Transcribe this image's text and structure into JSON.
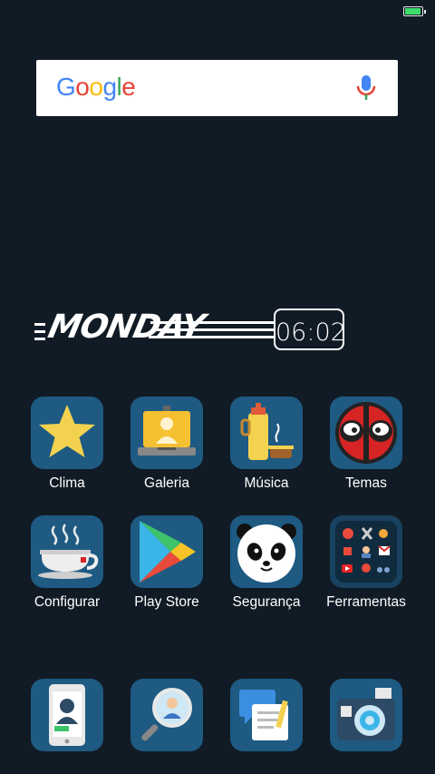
{
  "status_bar": {
    "battery_level": 1.0,
    "battery_color": "#3ddc6a"
  },
  "search": {
    "logo_text": "Google",
    "mic_icon": "mic-icon"
  },
  "clock_widget": {
    "day": "MONDAY",
    "time": "06:02"
  },
  "apps_row1": [
    {
      "label": "Clima",
      "icon": "star-icon"
    },
    {
      "label": "Galeria",
      "icon": "laptop-user-icon"
    },
    {
      "label": "Música",
      "icon": "thermos-icon"
    },
    {
      "label": "Temas",
      "icon": "deadpool-mask-icon"
    }
  ],
  "apps_row2": [
    {
      "label": "Configurar",
      "icon": "coffee-cup-icon"
    },
    {
      "label": "Play Store",
      "icon": "play-store-icon"
    },
    {
      "label": "Segurança",
      "icon": "panda-icon"
    },
    {
      "label": "Ferramentas",
      "icon": "tools-folder-icon"
    }
  ],
  "dock": [
    {
      "icon": "contacts-phone-icon"
    },
    {
      "icon": "magnifier-person-icon"
    },
    {
      "icon": "messages-notes-icon"
    },
    {
      "icon": "camera-icon"
    }
  ],
  "colors": {
    "background": "#111b25",
    "icon_tile": "#1e5a82"
  }
}
